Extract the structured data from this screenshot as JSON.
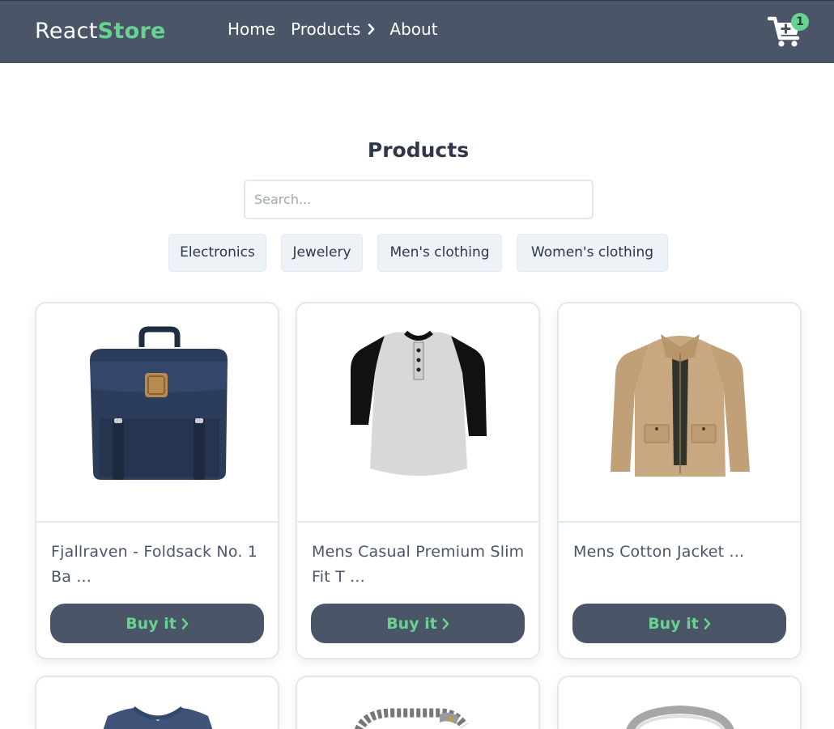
{
  "brand": {
    "part1": "React",
    "part2": "Store"
  },
  "nav": {
    "home": "Home",
    "products": "Products",
    "about": "About"
  },
  "cart": {
    "count": "1"
  },
  "main": {
    "title": "Products",
    "search_placeholder": "Search...",
    "filters": [
      "Electronics",
      "Jewelery",
      "Men's clothing",
      "Women's clothing"
    ]
  },
  "products": [
    {
      "name": "Fjallraven - Foldsack No. 1 Ba ...",
      "button": "Buy it",
      "image": "backpack"
    },
    {
      "name": "Mens Casual Premium Slim Fit T ...",
      "button": "Buy it",
      "image": "raglan-shirt"
    },
    {
      "name": "Mens Cotton Jacket ...",
      "button": "Buy it",
      "image": "jacket"
    },
    {
      "name": "",
      "button": "",
      "image": "blue-tshirt"
    },
    {
      "name": "",
      "button": "",
      "image": "bracelet"
    },
    {
      "name": "",
      "button": "",
      "image": "ring"
    }
  ],
  "colors": {
    "navbar": "#4a5568",
    "accent": "#68d391",
    "text": "#2d3748",
    "border": "#e2e8f0",
    "filter_bg": "#edf2f7"
  }
}
